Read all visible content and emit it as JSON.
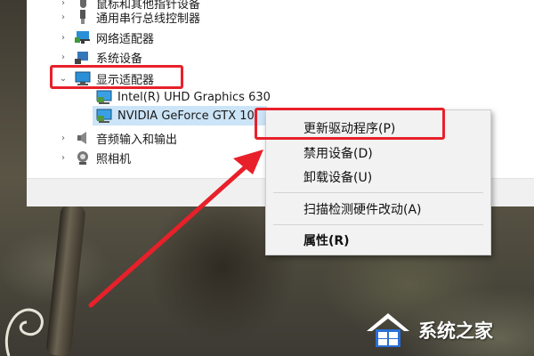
{
  "device_tree": {
    "items": [
      {
        "label": "鼠标和其他指针设备",
        "expander": "chevron-right",
        "icon": "mouse-icon"
      },
      {
        "label": "通用串行总线控制器",
        "expander": "chevron-right",
        "icon": "usb-icon"
      },
      {
        "label": "网络适配器",
        "expander": "chevron-right",
        "icon": "network-adapter-icon"
      },
      {
        "label": "系统设备",
        "expander": "chevron-right",
        "icon": "system-device-icon"
      },
      {
        "label": "显示适配器",
        "expander": "chevron-down",
        "icon": "display-adapter-icon"
      },
      {
        "label": "Intel(R) UHD Graphics 630",
        "expander": "",
        "icon": "display-card-icon"
      },
      {
        "label": "NVIDIA GeForce GTX 10",
        "expander": "",
        "icon": "display-card-icon",
        "selected": true
      },
      {
        "label": "音频输入和输出",
        "expander": "chevron-right",
        "icon": "speaker-icon"
      },
      {
        "label": "照相机",
        "expander": "chevron-right",
        "icon": "camera-icon"
      }
    ]
  },
  "context_menu": {
    "update_driver": "更新驱动程序(P)",
    "disable_device": "禁用设备(D)",
    "uninstall_device": "卸载设备(U)",
    "scan_hardware": "扫描检测硬件改动(A)",
    "properties": "属性(R)"
  },
  "watermark": {
    "text": "系统之家"
  },
  "colors": {
    "highlight_red": "#e8202a",
    "selection_blue": "#cce4f7",
    "menu_bg": "#f2f2f2"
  }
}
